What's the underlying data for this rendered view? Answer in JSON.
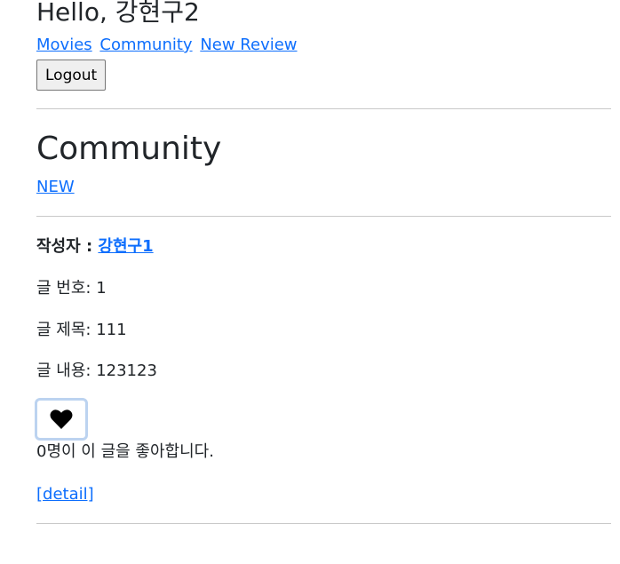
{
  "header": {
    "greeting": "Hello, 강현구2",
    "nav": {
      "movies": "Movies",
      "community": "Community",
      "new_review": "New Review"
    },
    "logout_label": "Logout"
  },
  "main": {
    "title": "Community",
    "new_link": "NEW"
  },
  "post": {
    "author_label": "작성자 : ",
    "author_name": "강현구1",
    "number_label": "글 번호: ",
    "number_value": "1",
    "title_label": "글 제목: ",
    "title_value": "111",
    "body_label": "글 내용: ",
    "body_value": "123123",
    "like_icon": "heart-icon",
    "like_count": "0",
    "like_text": "명이 이 글을 좋아합니다.",
    "detail_link": "[detail]"
  },
  "colors": {
    "link": "#0d6efd",
    "like_button_border": "#bcd3f0"
  }
}
